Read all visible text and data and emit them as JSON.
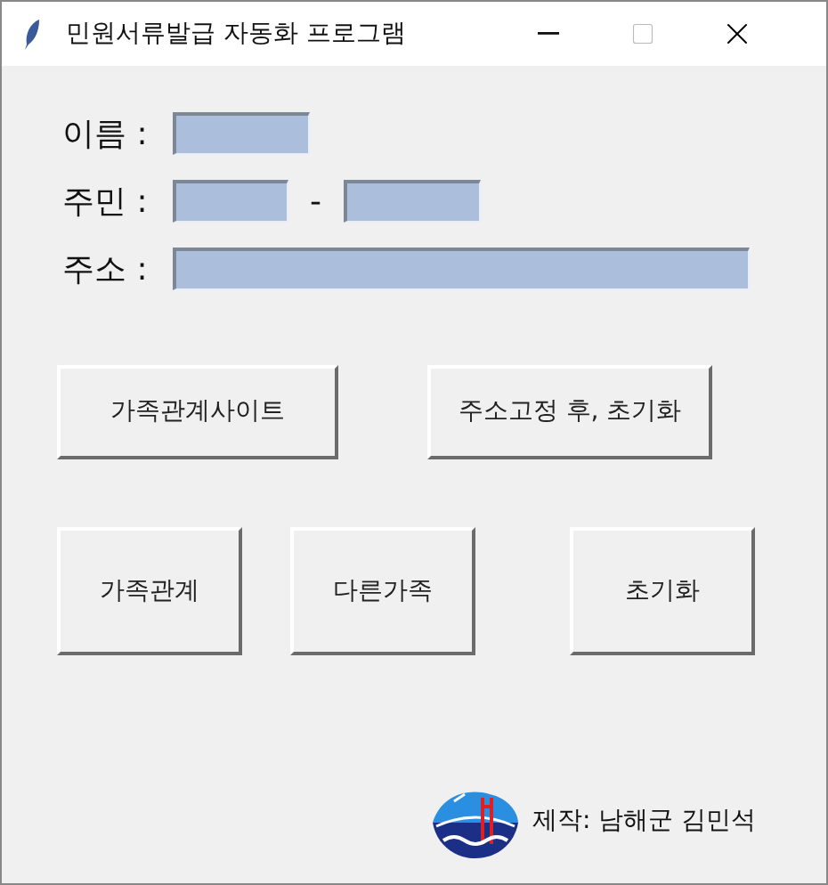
{
  "window": {
    "title": "민원서류발급 자동화 프로그램"
  },
  "form": {
    "name_label": "이름 :",
    "resident_label": "주민 :",
    "resident_separator": "-",
    "address_label": "주소 :"
  },
  "buttons_row_1": [
    "가족관계사이트",
    "주소고정 후, 초기화"
  ],
  "buttons_row_2": [
    "가족관계",
    "다른가족",
    "초기화"
  ],
  "footer": {
    "credit": "제작: 남해군 김민석"
  }
}
